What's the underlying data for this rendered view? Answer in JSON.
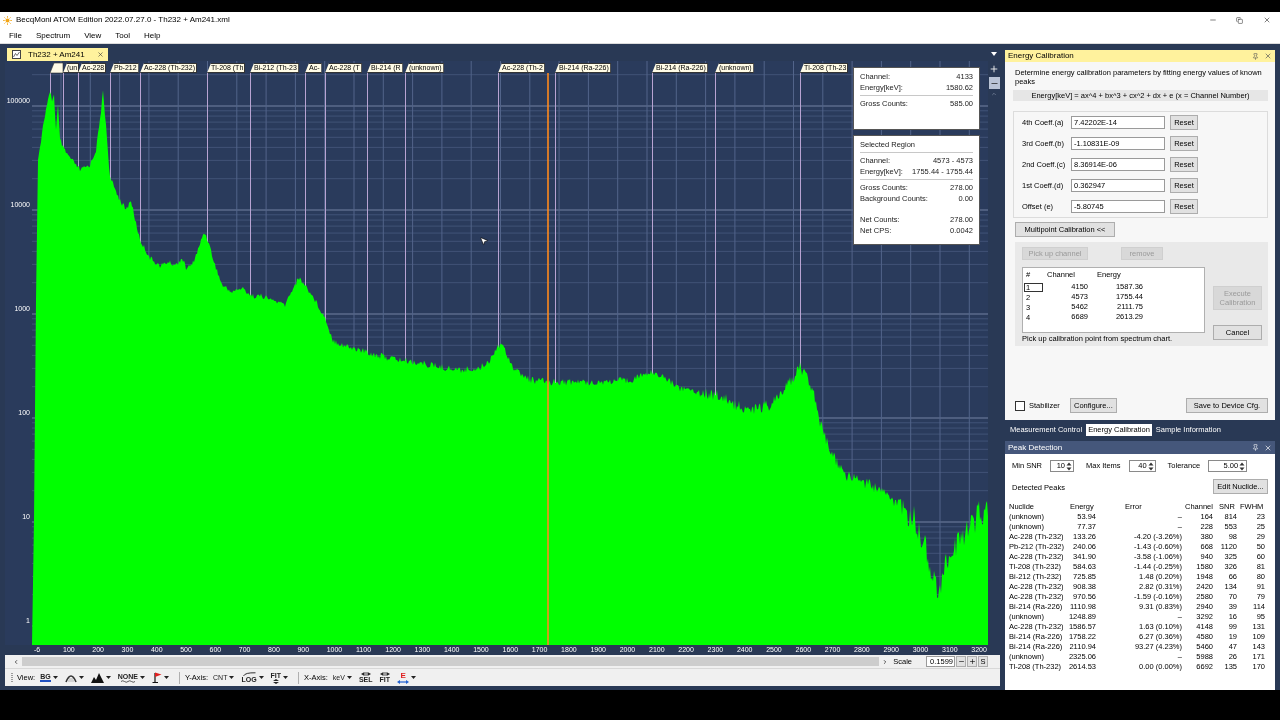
{
  "window": {
    "title": "BecqMoni ATOM Edition 2022.07.27.0 - Th232 + Am241.xml"
  },
  "menu": [
    "File",
    "Spectrum",
    "View",
    "Tool",
    "Help"
  ],
  "document_tab": {
    "label": "Th232 + Am241"
  },
  "spectrum": {
    "peak_flags": [
      "(un",
      "Ac-228",
      "Pb-212",
      "Ac-228 (Th-232)",
      "Tl-208 (Th",
      "Bi-212 (Th-23",
      "Ac-",
      "Ac-228 (T",
      "Bi-214 (R",
      "(unknown)",
      "Ac-228 (Th-2",
      "Bi-214 (Ra-226)",
      "Bi-214 (Ra-226)",
      "(unknown)",
      "Tl-208 (Th-23"
    ],
    "y_axis_labels": [
      "100000",
      "10000",
      "1000",
      "100",
      "10",
      "1"
    ],
    "x_axis_labels": [
      "-6",
      "100",
      "200",
      "300",
      "400",
      "500",
      "600",
      "700",
      "800",
      "900",
      "1000",
      "1100",
      "1200",
      "1300",
      "1400",
      "1500",
      "1600",
      "1700",
      "1800",
      "1900",
      "2000",
      "2100",
      "2200",
      "2300",
      "2400",
      "2500",
      "2600",
      "2700",
      "2800",
      "2900",
      "3000",
      "3100",
      "3200"
    ],
    "cursor_info": {
      "groups": [
        {
          "ruled": false,
          "rows": [
            {
              "label": "Channel:",
              "value": "4133"
            },
            {
              "label": "Energy[keV]:",
              "value": "1580.62"
            }
          ]
        },
        {
          "ruled": true,
          "rows": [
            {
              "label": "Gross Counts:",
              "value": "585.00"
            }
          ]
        }
      ]
    },
    "selected_region": {
      "title": "Selected Region",
      "groups": [
        {
          "ruled": true,
          "rows": [
            {
              "label": "Channel:",
              "value": "4573 - 4573"
            },
            {
              "label": "Energy[keV]:",
              "value": "1755.44 - 1755.44"
            }
          ]
        },
        {
          "ruled": true,
          "rows": [
            {
              "label": "Gross Counts:",
              "value": "278.00"
            },
            {
              "label": "Background Counts:",
              "value": "0.00"
            }
          ]
        },
        {
          "ruled": false,
          "rows": [
            {
              "label": "Net Counts:",
              "value": "278.00"
            },
            {
              "label": "Net CPS:",
              "value": "0.0042"
            }
          ]
        }
      ]
    }
  },
  "scale": {
    "label": "Scale",
    "value": "0.1599",
    "reset": "S"
  },
  "toolbar": {
    "sections": [
      {
        "label": "View:",
        "items": [
          {
            "kind": "underlined",
            "text": "BG",
            "dropdown": true
          },
          {
            "kind": "arc",
            "dropdown": true
          },
          {
            "kind": "peaks",
            "dropdown": true
          },
          {
            "kind": "wave",
            "text": "NONE",
            "dropdown": true
          },
          {
            "kind": "flag",
            "dropdown": true
          }
        ]
      },
      {
        "label": "Y-Axis:",
        "items": [
          {
            "kind": "plain",
            "text": "CNT",
            "dropdown": true
          },
          {
            "kind": "curve",
            "text": "LOG",
            "dropdown": true
          },
          {
            "kind": "vertical_arrows",
            "text": "FIT",
            "dropdown": true
          }
        ]
      },
      {
        "label": "X-Axis:",
        "items": [
          {
            "kind": "plain",
            "text": "keV",
            "dropdown": true
          },
          {
            "kind": "horizontal_arrows",
            "text": "SEL",
            "dropdown": false
          },
          {
            "kind": "horizontal_arrows",
            "text": "FIT",
            "dropdown": false
          },
          {
            "kind": "energy",
            "text": "E",
            "dropdown": true
          }
        ]
      }
    ]
  },
  "energy_calibration": {
    "title": "Energy Calibration",
    "description": "Determine energy calibration parameters by fitting energy values of known peaks",
    "formula": "Energy[keV] = ax^4 + bx^3 + cx^2 + dx + e (x = Channel Number)",
    "coefficients": [
      {
        "label": "4th Coeff.(a)",
        "value": "7.42202E-14",
        "button": "Reset"
      },
      {
        "label": "3rd Coeff.(b)",
        "value": "-1.10831E-09",
        "button": "Reset"
      },
      {
        "label": "2nd Coeff.(c)",
        "value": "8.36914E-06",
        "button": "Reset"
      },
      {
        "label": "1st Coeff.(d)",
        "value": "0.362947",
        "button": "Reset"
      },
      {
        "label": "Offset (e)",
        "value": "-5.80745",
        "button": "Reset"
      }
    ],
    "multipoint_button": "Multipoint Calibration <<",
    "pick_button": {
      "label": "Pick up channel",
      "disabled": true
    },
    "remove_button": {
      "label": "remove",
      "disabled": true
    },
    "points": {
      "columns": [
        "#",
        "Channel",
        "Energy"
      ],
      "rows": [
        {
          "cells": [
            "1",
            "4150",
            "1587.36"
          ],
          "selected": true
        },
        {
          "cells": [
            "2",
            "4573",
            "1755.44"
          ],
          "selected": false
        },
        {
          "cells": [
            "3",
            "5462",
            "2111.75"
          ],
          "selected": false
        },
        {
          "cells": [
            "4",
            "6689",
            "2613.29"
          ],
          "selected": false
        }
      ]
    },
    "execute_button": {
      "label": "Execute Calibration",
      "disabled": true
    },
    "cancel_button": {
      "label": "Cancel",
      "disabled": false
    },
    "hint": "Pick up calibration point from spectrum chart.",
    "stabilizer": {
      "label": "Stabilizer",
      "checked": false
    },
    "configure_button": "Configure...",
    "save_button": "Save to Device Cfg."
  },
  "side_tabs": [
    {
      "label": "Measurement Control",
      "selected": false
    },
    {
      "label": "Energy Calibration",
      "selected": true
    },
    {
      "label": "Sample Information",
      "selected": false
    }
  ],
  "peak_detection": {
    "title": "Peak Detection",
    "settings": [
      {
        "label": "Min SNR",
        "value": "10"
      },
      {
        "label": "Max Items",
        "value": "40"
      },
      {
        "label": "Tolerance",
        "value": "5.00"
      }
    ],
    "detected_label": "Detected Peaks",
    "edit_button": "Edit Nuclide...",
    "columns": [
      "Nuclide",
      "Energy",
      "Error",
      "Channel",
      "SNR",
      "FWHM"
    ],
    "rows": [
      [
        "(unknown)",
        "53.94",
        "–",
        "164",
        "814",
        "23"
      ],
      [
        "(unknown)",
        "77.37",
        "–",
        "228",
        "553",
        "25"
      ],
      [
        "Ac-228 (Th-232)",
        "133.26",
        "-4.20 (-3.26%)",
        "380",
        "98",
        "29"
      ],
      [
        "Pb-212 (Th-232)",
        "240.06",
        "-1.43 (-0.60%)",
        "668",
        "1120",
        "50"
      ],
      [
        "Ac-228 (Th-232)",
        "341.90",
        "-3.58 (-1.06%)",
        "940",
        "325",
        "60"
      ],
      [
        "Tl-208 (Th-232)",
        "584.63",
        "-1.44 (-0.25%)",
        "1580",
        "326",
        "81"
      ],
      [
        "Bi-212 (Th-232)",
        "725.85",
        "1.48 (0.20%)",
        "1948",
        "66",
        "80"
      ],
      [
        "Ac-228 (Th-232)",
        "908.38",
        "2.82 (0.31%)",
        "2420",
        "134",
        "91"
      ],
      [
        "Ac-228 (Th-232)",
        "970.56",
        "-1.59 (-0.16%)",
        "2580",
        "70",
        "79"
      ],
      [
        "Bi-214 (Ra-226)",
        "1110.98",
        "9.31 (0.83%)",
        "2940",
        "39",
        "114"
      ],
      [
        "(unknown)",
        "1248.89",
        "–",
        "3292",
        "16",
        "95"
      ],
      [
        "Ac-228 (Th-232)",
        "1586.57",
        "1.63 (0.10%)",
        "4148",
        "99",
        "131"
      ],
      [
        "Bi-214 (Ra-226)",
        "1758.22",
        "6.27 (0.36%)",
        "4580",
        "19",
        "109"
      ],
      [
        "Bi-214 (Ra-226)",
        "2110.94",
        "93.27 (4.23%)",
        "5460",
        "47",
        "143"
      ],
      [
        "(unknown)",
        "2325.06",
        "–",
        "5988",
        "26",
        "171"
      ],
      [
        "Tl-208 (Th-232)",
        "2614.53",
        "0.00 (0.00%)",
        "6692",
        "135",
        "170"
      ]
    ]
  }
}
